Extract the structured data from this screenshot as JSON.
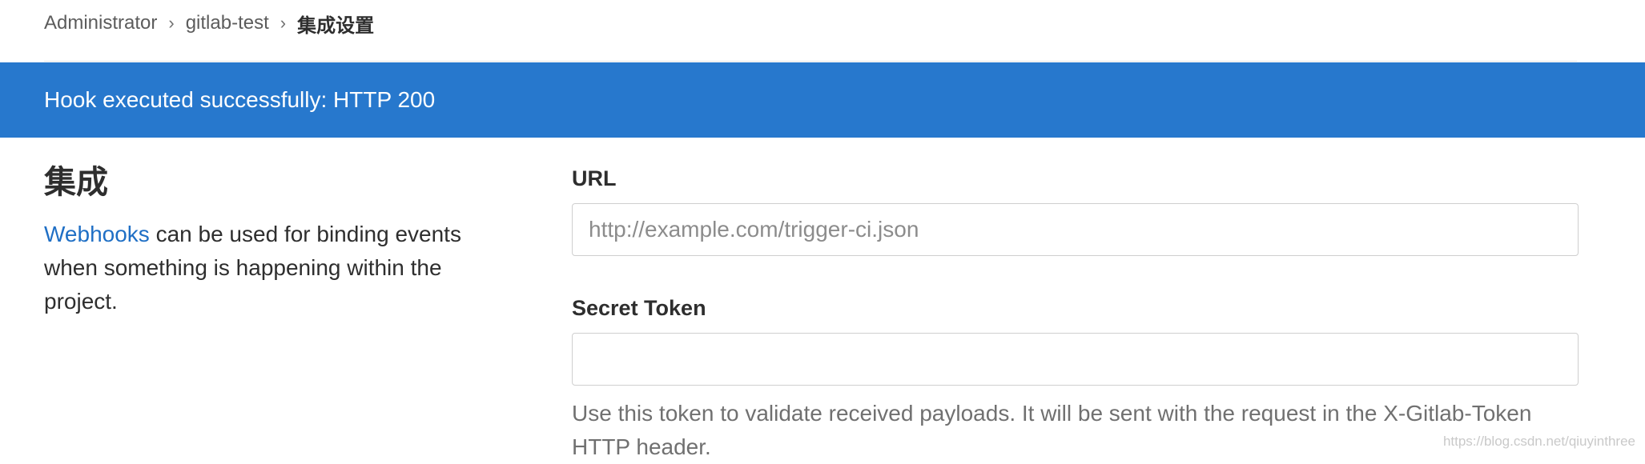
{
  "breadcrumb": {
    "items": [
      "Administrator",
      "gitlab-test",
      "集成设置"
    ],
    "separator": "›"
  },
  "flash": {
    "message": "Hook executed successfully: HTTP 200",
    "color": "#2778cd"
  },
  "integrations": {
    "title": "集成",
    "link_text": "Webhooks",
    "description": " can be used for binding events when something is happening within the project."
  },
  "form": {
    "url_label": "URL",
    "url_placeholder": "http://example.com/trigger-ci.json",
    "url_value": "",
    "token_label": "Secret Token",
    "token_value": "",
    "token_help": "Use this token to validate received payloads. It will be sent with the request in the X-Gitlab-Token HTTP header."
  },
  "watermark": "https://blog.csdn.net/qiuyinthree"
}
